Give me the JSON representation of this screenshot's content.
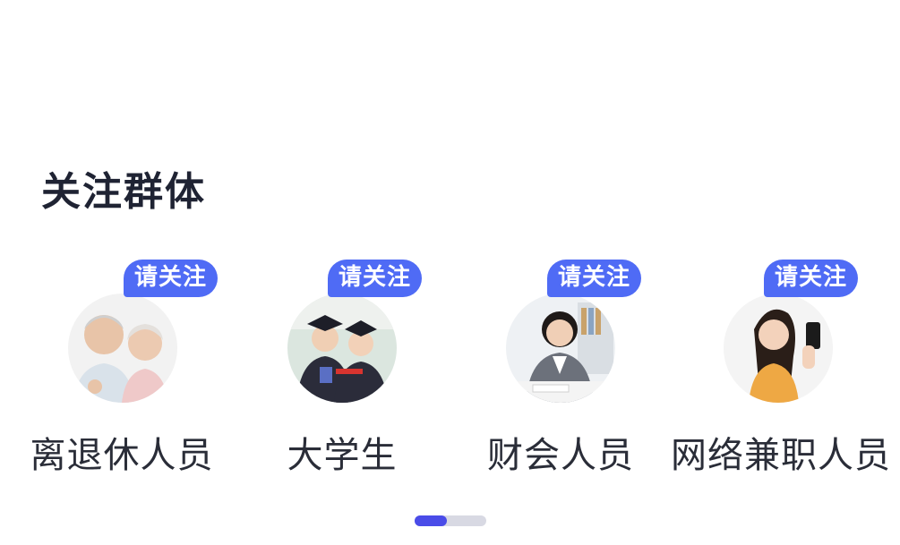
{
  "section": {
    "title": "关注群体"
  },
  "groups": [
    {
      "name": "离退休人员",
      "badge": "请关注",
      "image": "retirees-photo"
    },
    {
      "name": "大学生",
      "badge": "请关注",
      "image": "graduates-photo"
    },
    {
      "name": "财会人员",
      "badge": "请关注",
      "image": "accountant-photo"
    },
    {
      "name": "网络兼职人员",
      "badge": "请关注",
      "image": "online-parttime-photo"
    }
  ],
  "pager": {
    "total_pages": 2,
    "current_page": 1
  },
  "colors": {
    "badge": "#4f6bf5",
    "title": "#1f2333",
    "pager_active": "#4a4ce8",
    "pager_track": "#d8d9e3"
  }
}
